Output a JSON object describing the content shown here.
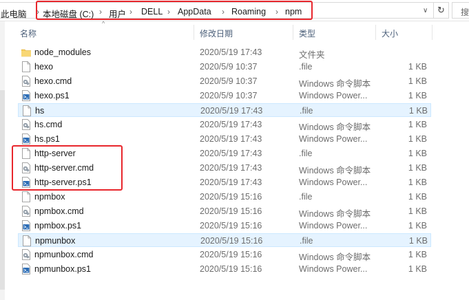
{
  "address": {
    "root": "此电脑",
    "crumbs": [
      "本地磁盘 (C:)",
      "用户",
      "DELL",
      "AppData",
      "Roaming",
      "npm"
    ],
    "dropdown_glyph": "∨",
    "refresh_glyph": "↻",
    "search_placeholder": "搜"
  },
  "columns": {
    "name": "名称",
    "date": "修改日期",
    "type": "类型",
    "size": "大小",
    "sort_indicator": "^"
  },
  "files": [
    {
      "name": "node_modules",
      "date": "2020/5/19 17:43",
      "type": "文件夹",
      "size": "",
      "icon": "folder-icon"
    },
    {
      "name": "hexo",
      "date": "2020/5/9 10:37",
      "type": ".file",
      "size": "1 KB",
      "icon": "file-icon"
    },
    {
      "name": "hexo.cmd",
      "date": "2020/5/9 10:37",
      "type": "Windows 命令脚本",
      "size": "1 KB",
      "icon": "cmd-script-icon"
    },
    {
      "name": "hexo.ps1",
      "date": "2020/5/9 10:37",
      "type": "Windows Power...",
      "size": "1 KB",
      "icon": "powershell-script-icon"
    },
    {
      "name": "hs",
      "date": "2020/5/19 17:43",
      "type": ".file",
      "size": "1 KB",
      "icon": "file-icon",
      "selected": true
    },
    {
      "name": "hs.cmd",
      "date": "2020/5/19 17:43",
      "type": "Windows 命令脚本",
      "size": "1 KB",
      "icon": "cmd-script-icon"
    },
    {
      "name": "hs.ps1",
      "date": "2020/5/19 17:43",
      "type": "Windows Power...",
      "size": "1 KB",
      "icon": "powershell-script-icon"
    },
    {
      "name": "http-server",
      "date": "2020/5/19 17:43",
      "type": ".file",
      "size": "1 KB",
      "icon": "file-icon"
    },
    {
      "name": "http-server.cmd",
      "date": "2020/5/19 17:43",
      "type": "Windows 命令脚本",
      "size": "1 KB",
      "icon": "cmd-script-icon"
    },
    {
      "name": "http-server.ps1",
      "date": "2020/5/19 17:43",
      "type": "Windows Power...",
      "size": "1 KB",
      "icon": "powershell-script-icon"
    },
    {
      "name": "npmbox",
      "date": "2020/5/19 15:16",
      "type": ".file",
      "size": "1 KB",
      "icon": "file-icon"
    },
    {
      "name": "npmbox.cmd",
      "date": "2020/5/19 15:16",
      "type": "Windows 命令脚本",
      "size": "1 KB",
      "icon": "cmd-script-icon"
    },
    {
      "name": "npmbox.ps1",
      "date": "2020/5/19 15:16",
      "type": "Windows Power...",
      "size": "1 KB",
      "icon": "powershell-script-icon"
    },
    {
      "name": "npmunbox",
      "date": "2020/5/19 15:16",
      "type": ".file",
      "size": "1 KB",
      "icon": "file-icon",
      "selected": true
    },
    {
      "name": "npmunbox.cmd",
      "date": "2020/5/19 15:16",
      "type": "Windows 命令脚本",
      "size": "1 KB",
      "icon": "cmd-script-icon"
    },
    {
      "name": "npmunbox.ps1",
      "date": "2020/5/19 15:16",
      "type": "Windows Power...",
      "size": "1 KB",
      "icon": "powershell-script-icon"
    }
  ],
  "colors": {
    "highlight_box": "#e8262c",
    "selection_bg": "#e5f3ff",
    "folder": "#f5cd5b"
  }
}
